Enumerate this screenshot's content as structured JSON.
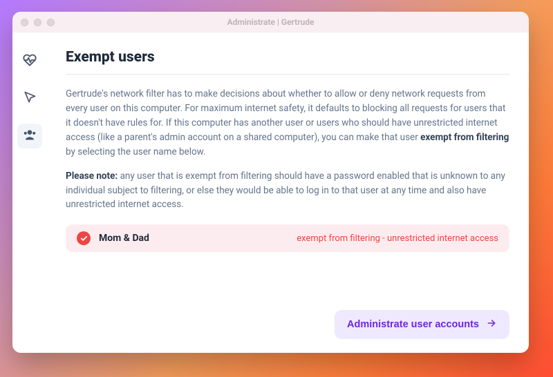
{
  "window": {
    "title": "Administrate  |  Gertrude"
  },
  "sidebar": {
    "items": [
      {
        "name": "health",
        "active": false
      },
      {
        "name": "actions",
        "active": false
      },
      {
        "name": "users",
        "active": true
      }
    ]
  },
  "page": {
    "title": "Exempt users",
    "para1_a": "Gertrude's network filter has to make decisions about whether to allow or deny network requests from every user on this computer. For maximum internet safety, it defaults to blocking all requests for users that it doesn't have rules for. If this computer has another user or users who should have unrestricted internet access (like a parent's admin account on a shared computer), you can make that user ",
    "para1_strong": "exempt from filtering",
    "para1_b": " by selecting the user name below.",
    "para2_lead": "Please note:",
    "para2_rest": " any user that is exempt from filtering should have a password enabled that is unknown to any individual subject to filtering, or else they would be able to log in to that user at any time and also have unrestricted internet access."
  },
  "users": [
    {
      "name": "Mom & Dad",
      "status": "exempt from filtering - unrestricted internet access",
      "exempt": true
    }
  ],
  "footer": {
    "admin_button": "Administrate user accounts"
  }
}
